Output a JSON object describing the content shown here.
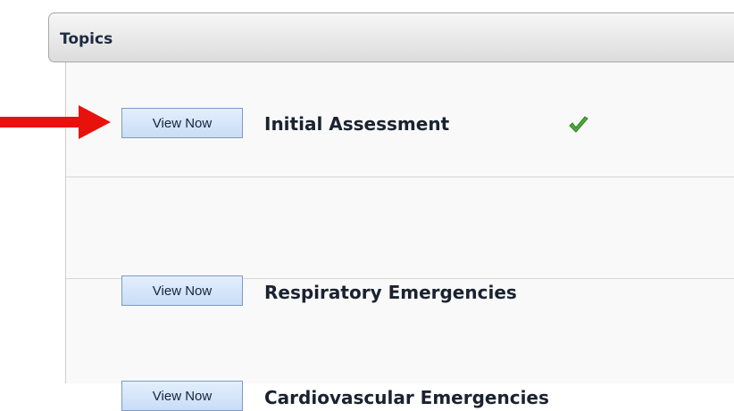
{
  "panel": {
    "title": "Topics"
  },
  "topics": [
    {
      "button_label": "View Now",
      "title": "Initial Assessment",
      "completed": true,
      "status_icon": "green-checkmark"
    },
    {
      "button_label": "View Now",
      "title": "Respiratory Emergencies",
      "completed": false
    },
    {
      "button_label": "View Now",
      "title": "Cardiovascular Emergencies",
      "completed": false
    }
  ],
  "annotation": {
    "icon": "red-arrow-pointing-right",
    "color": "#e8120c"
  },
  "colors": {
    "button_border": "#7c99c4",
    "button_fill": "#c9ddf7",
    "check_green": "#4caa3a",
    "arrow_red": "#e8120c"
  }
}
